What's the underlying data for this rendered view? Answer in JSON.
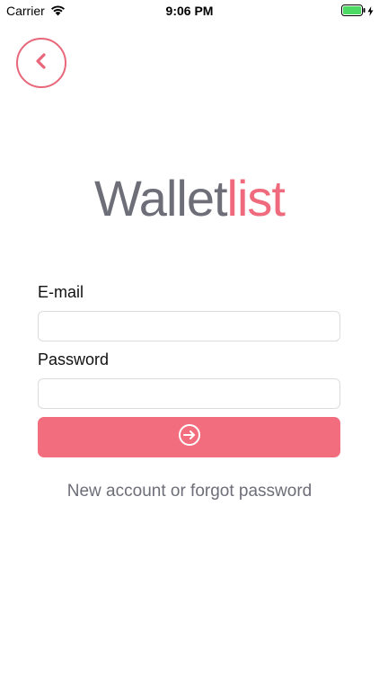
{
  "status_bar": {
    "carrier": "Carrier",
    "time": "9:06 PM",
    "wifi_icon": "wifi-icon",
    "battery_icon": "battery-icon",
    "charging_icon": "bolt-icon"
  },
  "header": {
    "back_icon": "chevron-left-icon"
  },
  "logo": {
    "part1": "Wallet",
    "part2": "list"
  },
  "form": {
    "email_label": "E-mail",
    "email_value": "",
    "password_label": "Password",
    "password_value": "",
    "submit_icon": "sign-in-icon"
  },
  "footer": {
    "account_link": "New account or forgot password"
  },
  "colors": {
    "accent": "#f26d7d",
    "logo_gray": "#6d6e78",
    "logo_pink": "#ef6a7c",
    "battery_green": "#4cd964"
  }
}
